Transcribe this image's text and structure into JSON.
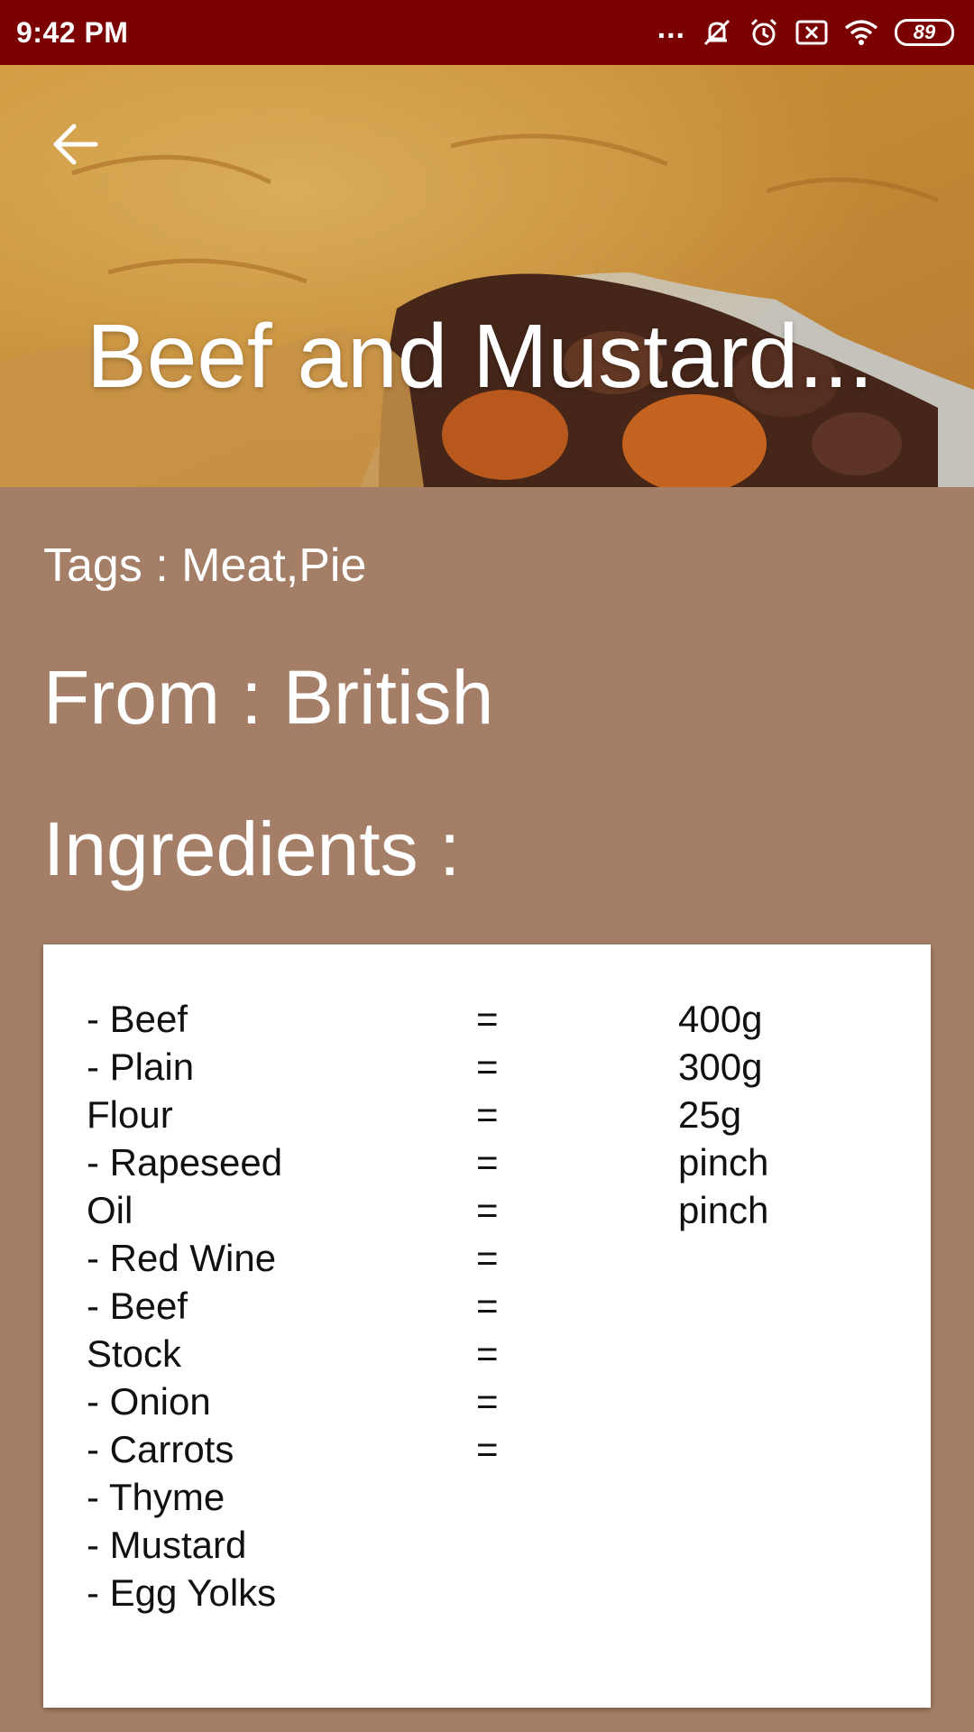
{
  "status_bar": {
    "time": "9:42 PM",
    "dots": "...",
    "battery": "89"
  },
  "meal": {
    "title": "Beef and Mustard...",
    "tags": "Tags : Meat,Pie",
    "origin": "From : British",
    "ingredients_heading": "Ingredients :"
  },
  "ingredients": {
    "names": [
      "- Beef",
      "- Plain",
      "Flour",
      "- Rapeseed",
      "Oil",
      "- Red Wine",
      "- Beef",
      "Stock",
      "- Onion",
      "- Carrots",
      "- Thyme",
      "- Mustard",
      "- Egg Yolks"
    ],
    "equals": [
      "=",
      "=",
      "=",
      "=",
      "=",
      "=",
      "=",
      "=",
      "=",
      "="
    ],
    "measures": [
      "400g",
      "300g",
      "25g",
      "pinch",
      "pinch"
    ]
  },
  "colors": {
    "status_bar": "#7b0000",
    "background": "#a47e66",
    "card": "#ffffff"
  }
}
